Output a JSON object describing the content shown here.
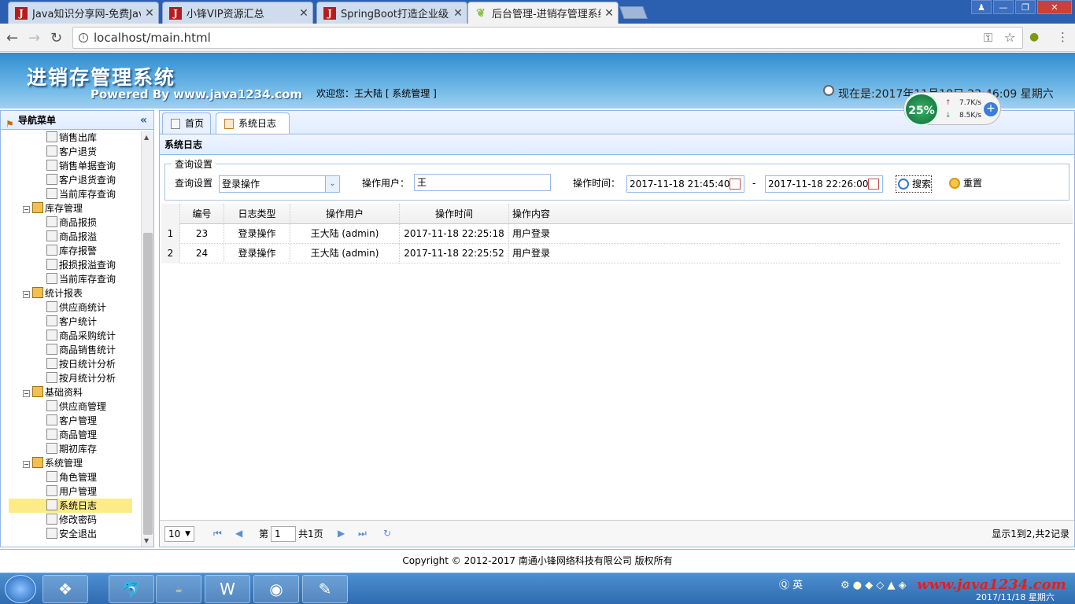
{
  "browser": {
    "tabs": [
      {
        "title": "Java知识分享网-免费Jav",
        "icon": "J"
      },
      {
        "title": "小锋VIP资源汇总",
        "icon": "J"
      },
      {
        "title": "SpringBoot打造企业级进",
        "icon": "J"
      },
      {
        "title": "后台管理-进销存管理系统",
        "icon": "leaf"
      }
    ],
    "url": "localhost/main.html"
  },
  "header": {
    "title": "进销存管理系统",
    "powered": "Powered By www.java1234.com",
    "welcome": "欢迎您：王大陆 [ 系统管理 ]",
    "clock": "现在是:2017年11月18日 22:46:09 星期六"
  },
  "netmonitor": {
    "cpu": "25%",
    "up": "7.7K/s",
    "down": "8.5K/s"
  },
  "sidebar": {
    "title": "导航菜单",
    "items": [
      {
        "label": "销售出库",
        "level": 2
      },
      {
        "label": "客户退货",
        "level": 2
      },
      {
        "label": "销售单据查询",
        "level": 2
      },
      {
        "label": "客户退货查询",
        "level": 2
      },
      {
        "label": "当前库存查询",
        "level": 2
      },
      {
        "label": "库存管理",
        "level": 1
      },
      {
        "label": "商品报损",
        "level": 2
      },
      {
        "label": "商品报溢",
        "level": 2
      },
      {
        "label": "库存报警",
        "level": 2
      },
      {
        "label": "报损报溢查询",
        "level": 2
      },
      {
        "label": "当前库存查询",
        "level": 2
      },
      {
        "label": "统计报表",
        "level": 1
      },
      {
        "label": "供应商统计",
        "level": 2
      },
      {
        "label": "客户统计",
        "level": 2
      },
      {
        "label": "商品采购统计",
        "level": 2
      },
      {
        "label": "商品销售统计",
        "level": 2
      },
      {
        "label": "按日统计分析",
        "level": 2
      },
      {
        "label": "按月统计分析",
        "level": 2
      },
      {
        "label": "基础资料",
        "level": 1
      },
      {
        "label": "供应商管理",
        "level": 2
      },
      {
        "label": "客户管理",
        "level": 2
      },
      {
        "label": "商品管理",
        "level": 2
      },
      {
        "label": "期初库存",
        "level": 2
      },
      {
        "label": "系统管理",
        "level": 1
      },
      {
        "label": "角色管理",
        "level": 2
      },
      {
        "label": "用户管理",
        "level": 2
      },
      {
        "label": "系统日志",
        "level": 2,
        "selected": true
      },
      {
        "label": "修改密码",
        "level": 2
      },
      {
        "label": "安全退出",
        "level": 2
      }
    ]
  },
  "apptabs": [
    {
      "label": "首页"
    },
    {
      "label": "系统日志",
      "close": "×",
      "active": true
    }
  ],
  "panel": {
    "title": "系统日志",
    "query": {
      "legend": "查询设置",
      "type_label": "查询设置",
      "type_value": "登录操作",
      "user_label": "操作用户：",
      "user_value": "王",
      "time_label": "操作时间：",
      "time_from": "2017-11-18 21:45:40",
      "dash": "-",
      "time_to": "2017-11-18 22:26:00",
      "search": "搜索",
      "reset": "重置"
    },
    "grid": {
      "columns": [
        "编号",
        "日志类型",
        "操作用户",
        "操作时间",
        "操作内容"
      ],
      "rows": [
        {
          "rn": "1",
          "id": "23",
          "type": "登录操作",
          "user": "王大陆 (admin)",
          "time": "2017-11-18 22:25:18",
          "content": "用户登录"
        },
        {
          "rn": "2",
          "id": "24",
          "type": "登录操作",
          "user": "王大陆 (admin)",
          "time": "2017-11-18 22:25:52",
          "content": "用户登录"
        }
      ]
    },
    "pager": {
      "page_size": "10",
      "page_prefix": "第",
      "page": "1",
      "page_total": "共1页",
      "summary": "显示1到2,共2记录"
    }
  },
  "footer": "Copyright © 2012-2017 南通小锋网络科技有限公司 版权所有",
  "taskbar": {
    "ime": "英",
    "watermark": "www.java1234.com",
    "date": "2017/11/18 星期六"
  }
}
